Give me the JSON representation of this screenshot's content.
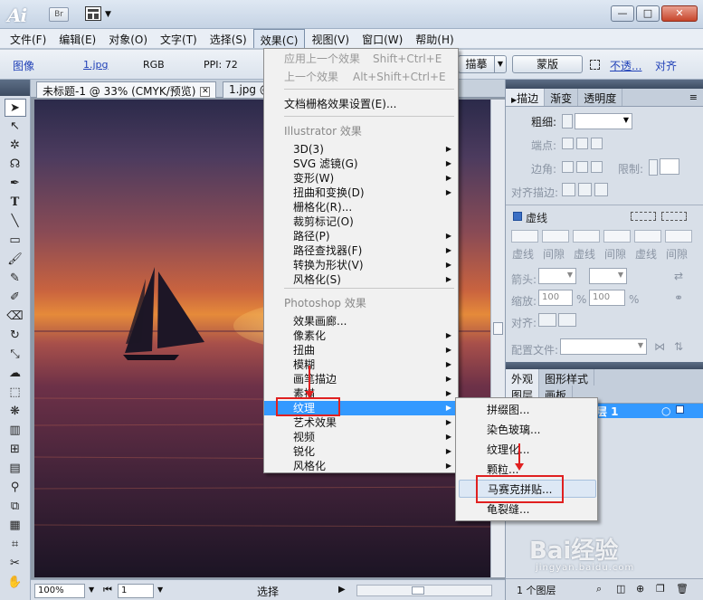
{
  "app": {
    "logo": "Ai",
    "bridge_label": "Br",
    "window_controls": [
      "—",
      "□",
      "✕"
    ]
  },
  "menubar": [
    {
      "label": "文件(F)"
    },
    {
      "label": "编辑(E)"
    },
    {
      "label": "对象(O)"
    },
    {
      "label": "文字(T)"
    },
    {
      "label": "选择(S)"
    },
    {
      "label": "效果(C)"
    },
    {
      "label": "视图(V)"
    },
    {
      "label": "窗口(W)"
    },
    {
      "label": "帮助(H)"
    }
  ],
  "controlbar": {
    "type_link": "图像",
    "file_link": "1.jpg",
    "color_mode": "RGB",
    "ppi": "PPI: 72",
    "trace_button": "描摹",
    "mask_button": "蒙版",
    "opacity_link": "不透...",
    "align_link": "对齐"
  },
  "doc": {
    "tab1": "未标题-1 @ 33% (CMYK/预览)",
    "tab2": "1.jpg @"
  },
  "statusbar": {
    "zoom": "100%",
    "page": "1",
    "mode": "选择"
  },
  "effect_menu": {
    "apply_last": "应用上一个效果",
    "apply_last_shortcut": "Shift+Ctrl+E",
    "last_effect": "上一个效果",
    "last_effect_shortcut": "Alt+Shift+Ctrl+E",
    "raster_settings": "文档栅格效果设置(E)...",
    "illustrator_header": "Illustrator 效果",
    "illustrator_items": [
      {
        "label": "3D(3)",
        "arrow": "▶"
      },
      {
        "label": "SVG 滤镜(G)",
        "arrow": "▶"
      },
      {
        "label": "变形(W)",
        "arrow": "▶"
      },
      {
        "label": "扭曲和变换(D)",
        "arrow": "▶"
      },
      {
        "label": "栅格化(R)...",
        "arrow": ""
      },
      {
        "label": "裁剪标记(O)",
        "arrow": ""
      },
      {
        "label": "路径(P)",
        "arrow": "▶"
      },
      {
        "label": "路径查找器(F)",
        "arrow": "▶"
      },
      {
        "label": "转换为形状(V)",
        "arrow": "▶"
      },
      {
        "label": "风格化(S)",
        "arrow": "▶"
      }
    ],
    "photoshop_header": "Photoshop 效果",
    "photoshop_items": [
      {
        "label": "效果画廊...",
        "arrow": ""
      },
      {
        "label": "像素化",
        "arrow": "▶"
      },
      {
        "label": "扭曲",
        "arrow": "▶"
      },
      {
        "label": "模糊",
        "arrow": "▶"
      },
      {
        "label": "画笔描边",
        "arrow": "▶"
      },
      {
        "label": "素描",
        "arrow": "▶"
      },
      {
        "label": "纹理",
        "arrow": "▶"
      },
      {
        "label": "艺术效果",
        "arrow": "▶"
      },
      {
        "label": "视频",
        "arrow": "▶"
      },
      {
        "label": "锐化",
        "arrow": "▶"
      },
      {
        "label": "风格化",
        "arrow": "▶"
      }
    ]
  },
  "texture_submenu": {
    "items": [
      "拼缀图...",
      "染色玻璃...",
      "纹理化...",
      "颗粒...",
      "马赛克拼贴...",
      "龟裂缝..."
    ]
  },
  "stroke_panel": {
    "tabs": [
      "描边",
      "渐变",
      "透明度"
    ],
    "weight_label": "粗细:",
    "cap_label": "端点:",
    "corner_label": "边角:",
    "limit_label": "限制:",
    "align_label": "对齐描边:",
    "dashed_label": "虚线",
    "dash_labels": [
      "虚线",
      "间隙",
      "虚线",
      "间隙",
      "虚线",
      "间隙"
    ],
    "arrow_label": "箭头:",
    "scale_label": "缩放:",
    "scale_value_1": "100",
    "scale_value_2": "100",
    "percent": "%",
    "align2_label": "对齐:",
    "profile_label": "配置文件:"
  },
  "appearance_panel": {
    "tabs": [
      "外观",
      "图形样式"
    ]
  },
  "layers_panel": {
    "tabs": [
      "图层",
      "画板"
    ],
    "layer_name": "层 1",
    "footer": "1 个图层"
  },
  "watermark": {
    "text": "Bai经验",
    "sub": "jingyan.baidu.com"
  }
}
